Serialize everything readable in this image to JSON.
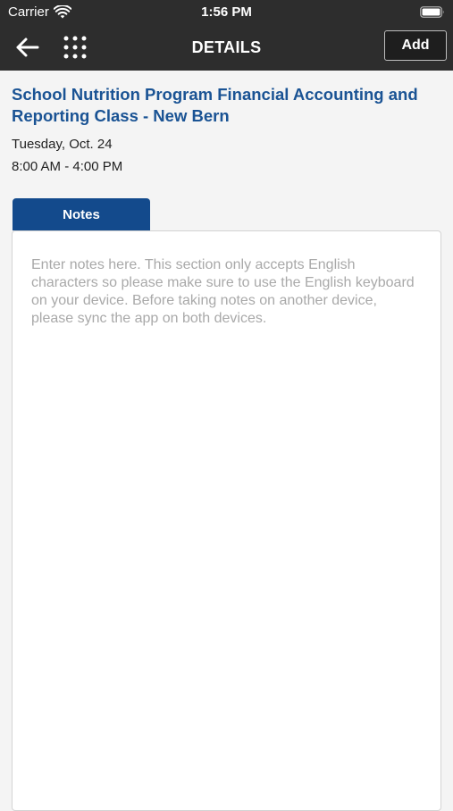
{
  "status_bar": {
    "carrier": "Carrier",
    "time": "1:56 PM"
  },
  "nav": {
    "title": "DETAILS",
    "add_label": "Add",
    "back_icon": "arrow-left-icon",
    "menu_icon": "grid-dots-icon"
  },
  "event": {
    "title": "School Nutrition Program Financial Accounting and Reporting Class - New Bern",
    "date": "Tuesday, Oct. 24",
    "time": "8:00 AM - 4:00 PM"
  },
  "notes": {
    "tab_label": "Notes",
    "placeholder": "Enter notes here. This section only accepts English characters so please make sure to use the English keyboard on your device. Before taking notes on another device, please sync the app on both devices.",
    "value": ""
  },
  "colors": {
    "header_bg": "#2d2d2d",
    "accent_blue": "#1a5394",
    "tab_blue": "#134a8c",
    "page_bg": "#f4f4f4"
  }
}
